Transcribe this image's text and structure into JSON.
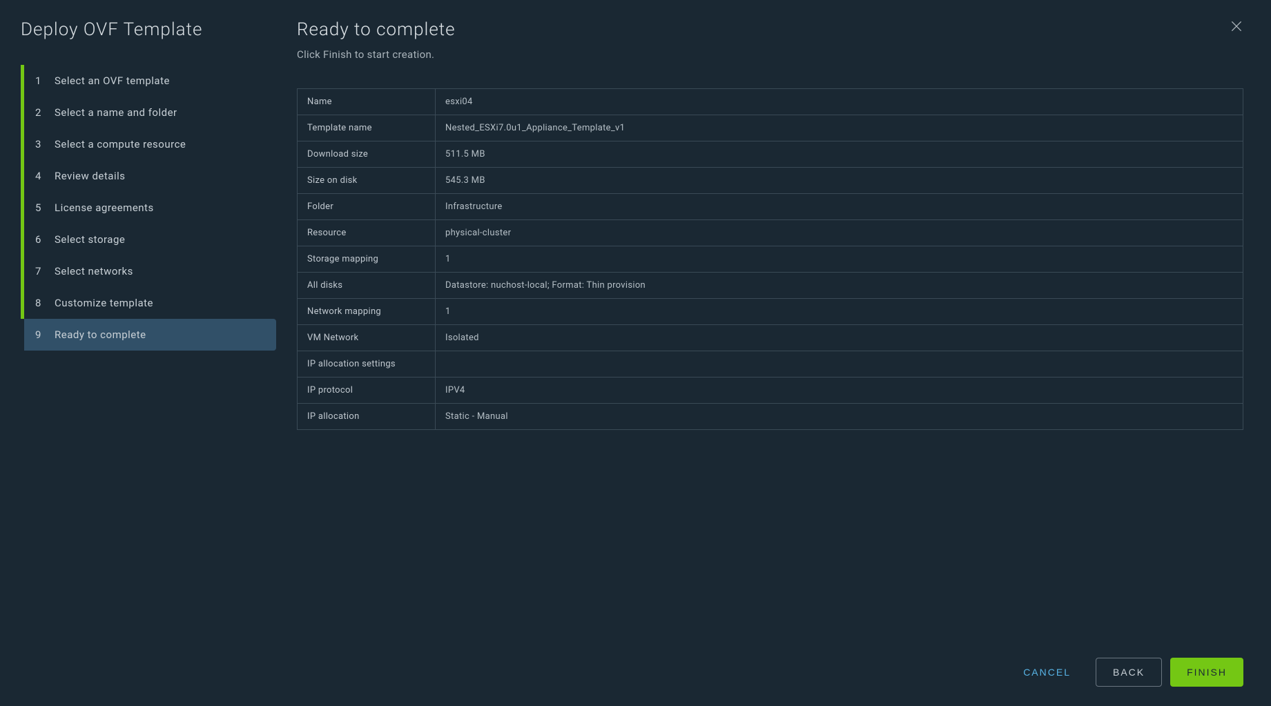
{
  "wizard": {
    "title": "Deploy OVF Template",
    "steps": [
      {
        "num": "1",
        "label": "Select an OVF template"
      },
      {
        "num": "2",
        "label": "Select a name and folder"
      },
      {
        "num": "3",
        "label": "Select a compute resource"
      },
      {
        "num": "4",
        "label": "Review details"
      },
      {
        "num": "5",
        "label": "License agreements"
      },
      {
        "num": "6",
        "label": "Select storage"
      },
      {
        "num": "7",
        "label": "Select networks"
      },
      {
        "num": "8",
        "label": "Customize template"
      },
      {
        "num": "9",
        "label": "Ready to complete"
      }
    ]
  },
  "content": {
    "title": "Ready to complete",
    "subtitle": "Click Finish to start creation."
  },
  "summary": [
    {
      "label": "Name",
      "value": "esxi04"
    },
    {
      "label": "Template name",
      "value": "Nested_ESXi7.0u1_Appliance_Template_v1"
    },
    {
      "label": "Download size",
      "value": "511.5 MB"
    },
    {
      "label": "Size on disk",
      "value": "545.3 MB"
    },
    {
      "label": "Folder",
      "value": "Infrastructure"
    },
    {
      "label": "Resource",
      "value": "physical-cluster"
    },
    {
      "label": "Storage mapping",
      "value": "1"
    },
    {
      "label": "All disks",
      "value": "Datastore: nuchost-local; Format: Thin provision"
    },
    {
      "label": "Network mapping",
      "value": "1"
    },
    {
      "label": "VM Network",
      "value": "Isolated"
    },
    {
      "label": "IP allocation settings",
      "value": ""
    },
    {
      "label": "IP protocol",
      "value": "IPV4"
    },
    {
      "label": "IP allocation",
      "value": "Static - Manual"
    }
  ],
  "buttons": {
    "cancel": "CANCEL",
    "back": "BACK",
    "finish": "FINISH"
  }
}
